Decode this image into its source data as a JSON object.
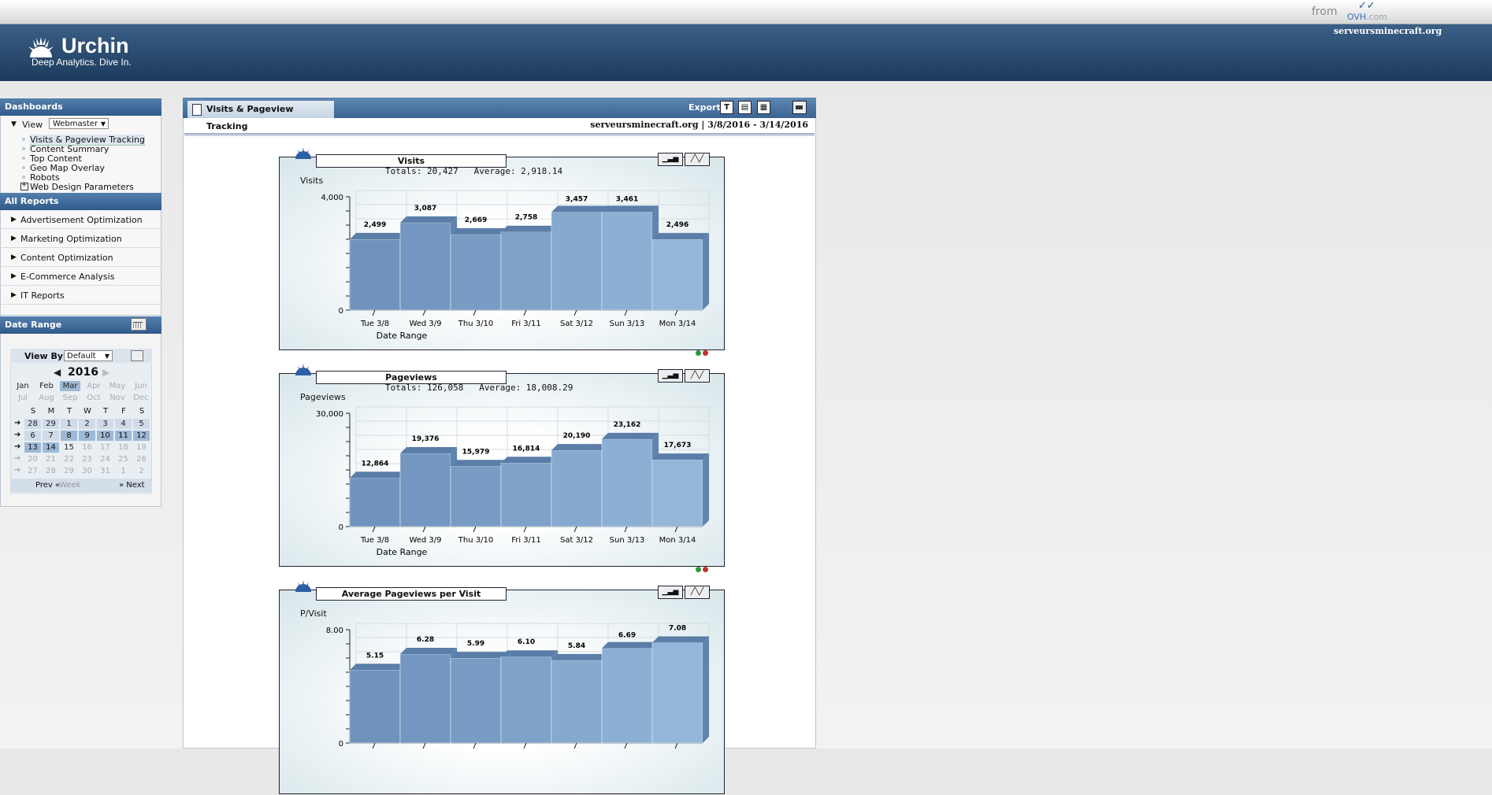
{
  "topbar": {
    "from": "from",
    "ovh_name": "OVH",
    "ovh_suffix": ".com"
  },
  "header": {
    "brand": "Urchin",
    "tagline": "Deep Analytics. Dive In.",
    "site": "serveursminecraft.org"
  },
  "sidebar": {
    "dashboards_title": "Dashboards",
    "view_label": "View",
    "view_value": "Webmaster",
    "dashboard_items": [
      "Visits & Pageview Tracking",
      "Content Summary",
      "Top Content",
      "Geo Map Overlay",
      "Robots",
      "Web Design Parameters"
    ],
    "all_reports_title": "All Reports",
    "reports": [
      "Advertisement Optimization",
      "Marketing Optimization",
      "Content Optimization",
      "E-Commerce Analysis",
      "IT Reports"
    ]
  },
  "date_range": {
    "title": "Date Range",
    "view_by_label": "View By",
    "view_by_value": "Default",
    "year": "2016",
    "months_row1": [
      "Jan",
      "Feb",
      "Mar",
      "Apr",
      "May",
      "Jun"
    ],
    "months_row2": [
      "Jul",
      "Aug",
      "Sep",
      "Oct",
      "Nov",
      "Dec"
    ],
    "dow": [
      "S",
      "M",
      "T",
      "W",
      "T",
      "F",
      "S"
    ],
    "weeks": [
      [
        "28",
        "29",
        "1",
        "2",
        "3",
        "4",
        "5"
      ],
      [
        "6",
        "7",
        "8",
        "9",
        "10",
        "11",
        "12"
      ],
      [
        "13",
        "14",
        "15",
        "16",
        "17",
        "18",
        "19"
      ],
      [
        "20",
        "21",
        "22",
        "23",
        "24",
        "25",
        "26"
      ],
      [
        "27",
        "28",
        "29",
        "30",
        "31",
        "1",
        "2"
      ]
    ],
    "prev": "Prev",
    "week": "Week",
    "next": "Next"
  },
  "main": {
    "tab_title": "Visits & Pageview Tracking",
    "export_label": "Export",
    "info": "serveursminecraft.org  |  3/8/2016 - 3/14/2016"
  },
  "chart_data": [
    {
      "type": "bar",
      "title": "Visits",
      "totals": "Totals: 20,427   Average: 2,918.14",
      "ylabel": "Visits",
      "xlabel": "Date Range",
      "categories": [
        "Tue 3/8",
        "Wed 3/9",
        "Thu 3/10",
        "Fri 3/11",
        "Sat 3/12",
        "Sun 3/13",
        "Mon 3/14"
      ],
      "values": [
        2499,
        3087,
        2669,
        2758,
        3457,
        3461,
        2496
      ],
      "labels": [
        "2,499",
        "3,087",
        "2,669",
        "2,758",
        "3,457",
        "3,461",
        "2,496"
      ],
      "ylim": [
        0,
        4000
      ],
      "ytick_labels": [
        "0",
        "4,000"
      ]
    },
    {
      "type": "bar",
      "title": "Pageviews",
      "totals": "Totals: 126,058   Average: 18,008.29",
      "ylabel": "Pageviews",
      "xlabel": "Date Range",
      "categories": [
        "Tue 3/8",
        "Wed 3/9",
        "Thu 3/10",
        "Fri 3/11",
        "Sat 3/12",
        "Sun 3/13",
        "Mon 3/14"
      ],
      "values": [
        12864,
        19376,
        15979,
        16814,
        20190,
        23162,
        17673
      ],
      "labels": [
        "12,864",
        "19,376",
        "15,979",
        "16,814",
        "20,190",
        "23,162",
        "17,673"
      ],
      "ylim": [
        0,
        30000
      ],
      "ytick_labels": [
        "0",
        "30,000"
      ]
    },
    {
      "type": "bar",
      "title": "Average Pageviews per Visit",
      "totals": "",
      "ylabel": "P/Visit",
      "xlabel": "",
      "categories": [
        "",
        "",
        "",
        "",
        "",
        "",
        ""
      ],
      "values": [
        5.15,
        6.28,
        5.99,
        6.1,
        5.84,
        6.69,
        7.08
      ],
      "labels": [
        "5.15",
        "6.28",
        "5.99",
        "6.10",
        "5.84",
        "6.69",
        "7.08"
      ],
      "ylim": [
        0,
        8
      ],
      "ytick_labels": [
        "0",
        "8.00"
      ]
    }
  ],
  "colors": {
    "header": "#2a4d73",
    "bar_front": "#7f9fc6",
    "bar_top": "#5c7fa8",
    "accent": "#9eb9d6"
  }
}
